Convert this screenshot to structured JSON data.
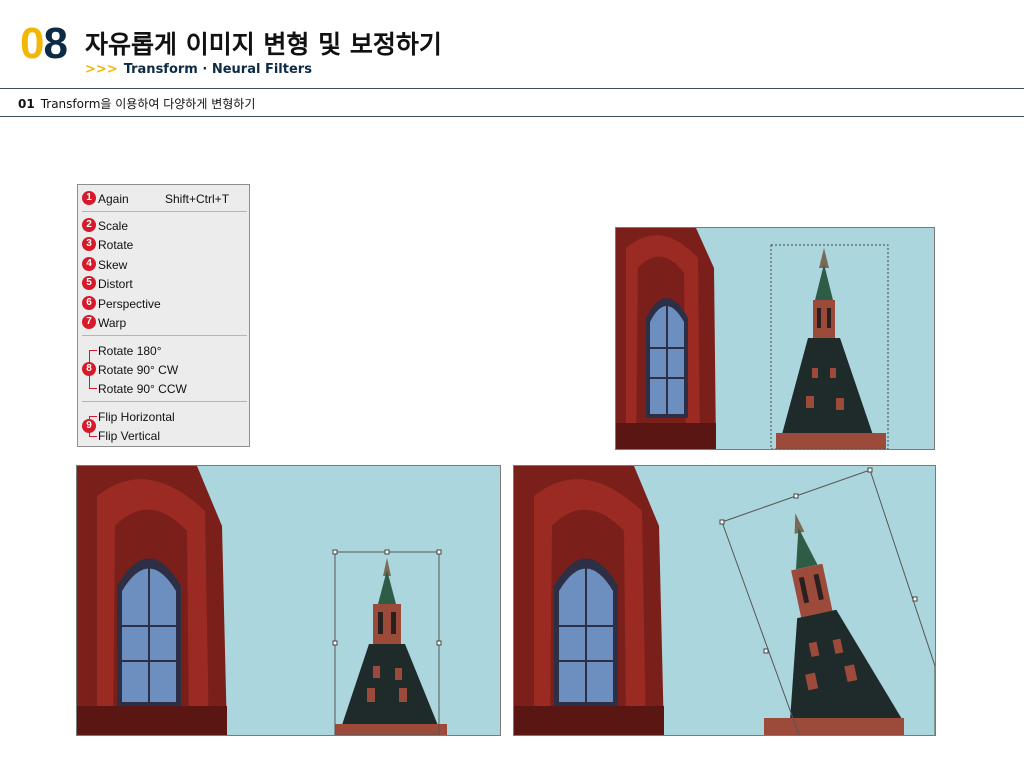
{
  "header": {
    "chapter_digit_1": "0",
    "chapter_digit_2": "8",
    "title": "자유롭게 이미지 변형 및 보정하기",
    "subtitle_arrows": ">>>",
    "subtitle": "Transform · Neural Filters"
  },
  "section": {
    "number": "01",
    "title": "Transform을 이용하여 다양하게 변형하기"
  },
  "menu": {
    "items": [
      {
        "badge": "1",
        "label": "Again",
        "shortcut": "Shift+Ctrl+T"
      },
      {
        "badge": "2",
        "label": "Scale"
      },
      {
        "badge": "3",
        "label": "Rotate"
      },
      {
        "badge": "4",
        "label": "Skew"
      },
      {
        "badge": "5",
        "label": "Distort"
      },
      {
        "badge": "6",
        "label": "Perspective"
      },
      {
        "badge": "7",
        "label": "Warp"
      },
      {
        "badge": "8",
        "label": "Rotate 180°"
      },
      {
        "label": "Rotate 90° CW"
      },
      {
        "label": "Rotate 90° CCW"
      },
      {
        "badge": "9",
        "label": "Flip Horizontal"
      },
      {
        "label": "Flip Vertical"
      }
    ]
  },
  "colors": {
    "accent_yellow": "#f2b705",
    "navy": "#0d2b45",
    "badge_red": "#d61a2a",
    "sky": "#abd6dd",
    "brick": "#7a1f1a"
  }
}
